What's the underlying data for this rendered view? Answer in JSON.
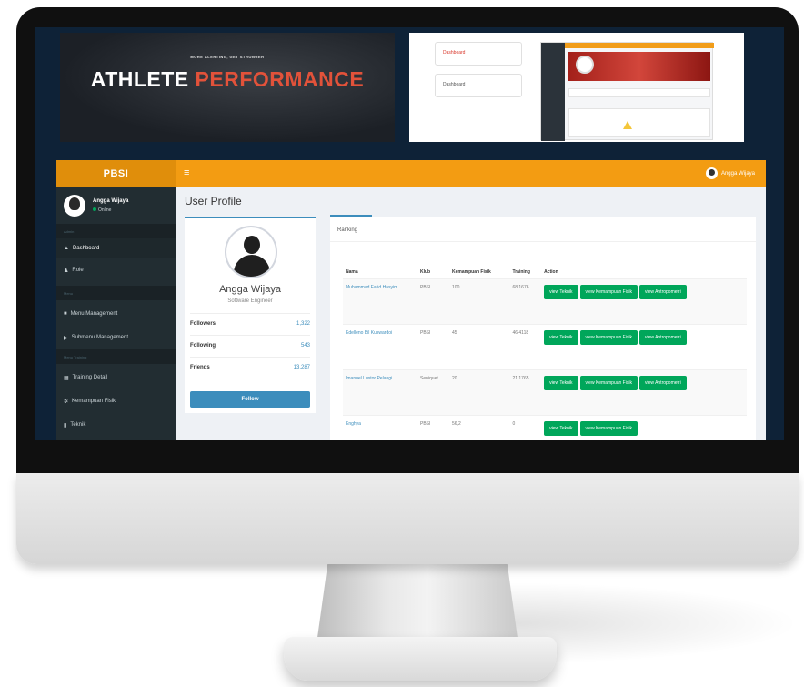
{
  "banner": {
    "kicker": "MORE ALERTING, GET STRONGER",
    "title_main": "ATHLETE",
    "title_accent": "PERFORMANCE"
  },
  "preview": {
    "btn1": "Dashboard",
    "btn2": "Dashboard"
  },
  "app": {
    "brand": "PBSI",
    "menu_icon": "≡",
    "top_user": "Angga Wijaya",
    "sidebar": {
      "user_name": "Angga Wijaya",
      "user_status": "Online",
      "headers": [
        "Admin",
        "Menu",
        "Menu Training"
      ],
      "items": [
        {
          "icon": "home-icon",
          "glyph": "▲",
          "label": "Dashboard"
        },
        {
          "icon": "user-icon",
          "glyph": "♟",
          "label": "Role"
        },
        {
          "icon": "folder-icon",
          "glyph": "■",
          "label": "Menu Management"
        },
        {
          "icon": "folder-open-icon",
          "glyph": "▶",
          "label": "Submenu Management"
        },
        {
          "icon": "table-icon",
          "glyph": "▦",
          "label": "Training Detail"
        },
        {
          "icon": "gear-icon",
          "glyph": "✲",
          "label": "Kemampuan Fisik"
        },
        {
          "icon": "chart-icon",
          "glyph": "▮",
          "label": "Teknik"
        }
      ]
    },
    "page_title": "User Profile",
    "profile": {
      "name": "Angga Wijaya",
      "role": "Software Engineer",
      "stats": [
        {
          "label": "Followers",
          "value": "1,322"
        },
        {
          "label": "Following",
          "value": "543"
        },
        {
          "label": "Friends",
          "value": "13,287"
        }
      ],
      "follow_label": "Follow"
    },
    "ranking": {
      "tab_label": "Ranking",
      "columns": [
        "Nama",
        "Klub",
        "Kemampuan Fisik",
        "Training",
        "Action"
      ],
      "rows": [
        {
          "nama": "Muhammad Farid Hasyim",
          "klub": "PBSI",
          "fisik": "100",
          "training": "68,1676"
        },
        {
          "nama": "Edelleno Bil Kuswardoi",
          "klub": "PBSI",
          "fisik": "45",
          "training": "46,4118"
        },
        {
          "nama": "Imanuel Lustor Pelangi",
          "klub": "Seniquet",
          "fisik": "20",
          "training": "21,1765"
        },
        {
          "nama": "Enghya",
          "klub": "PBSI",
          "fisik": "56,2",
          "training": "0"
        }
      ],
      "actions": [
        "view Teknik",
        "view Kemampuan Fisik",
        "view Antropometri"
      ]
    }
  }
}
